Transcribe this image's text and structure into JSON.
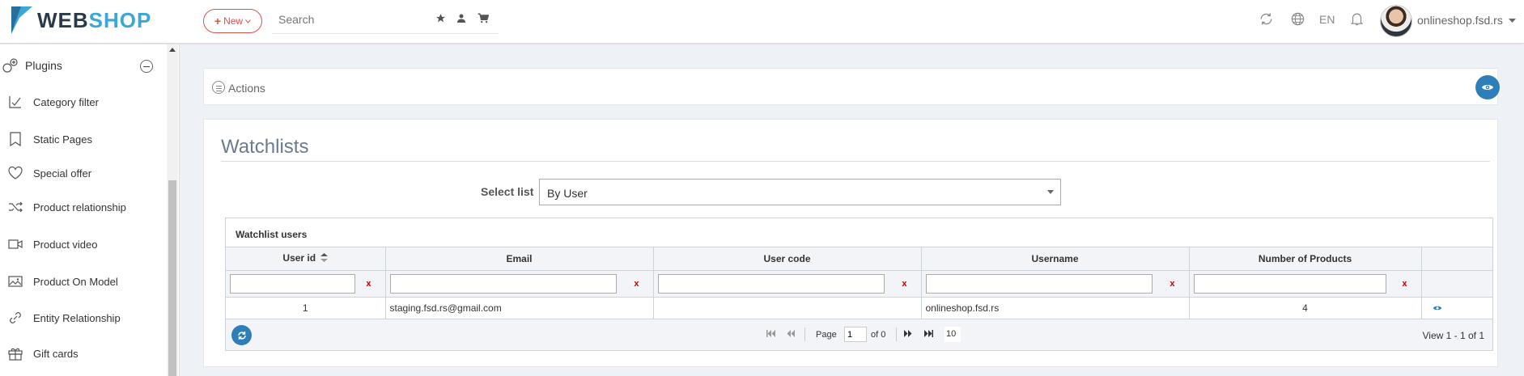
{
  "header": {
    "logo_web": "WEB",
    "logo_shop": "SHOP",
    "new_label": "New",
    "search_placeholder": "Search",
    "lang": "EN",
    "user": "onlineshop.fsd.rs"
  },
  "sidebar": {
    "section": "Plugins",
    "items": [
      {
        "label": "Category filter",
        "icon": "checkbox-chart-icon"
      },
      {
        "label": "Static Pages",
        "icon": "bookmark-icon"
      },
      {
        "label": "Special offer",
        "icon": "heart-icon"
      },
      {
        "label": "Product relationship",
        "icon": "shuffle-icon"
      },
      {
        "label": "Product video",
        "icon": "video-icon"
      },
      {
        "label": "Product On Model",
        "icon": "image-icon"
      },
      {
        "label": "Entity Relationship",
        "icon": "link-icon"
      },
      {
        "label": "Gift cards",
        "icon": "gift-icon"
      }
    ]
  },
  "actions": {
    "label": "Actions"
  },
  "main": {
    "title": "Watchlists",
    "select_label": "Select list",
    "select_value": "By User"
  },
  "grid": {
    "caption": "Watchlist users",
    "columns": [
      "User id",
      "Email",
      "User code",
      "Username",
      "Number of Products"
    ],
    "clear_label": "x",
    "rows": [
      {
        "user_id": "1",
        "email": "staging.fsd.rs@gmail.com",
        "user_code": "",
        "username": "onlineshop.fsd.rs",
        "products": "4"
      }
    ],
    "pager": {
      "page_label": "Page",
      "page": "1",
      "of_label": "of 0",
      "rows": "10",
      "view": "View 1 - 1 of 1"
    }
  }
}
